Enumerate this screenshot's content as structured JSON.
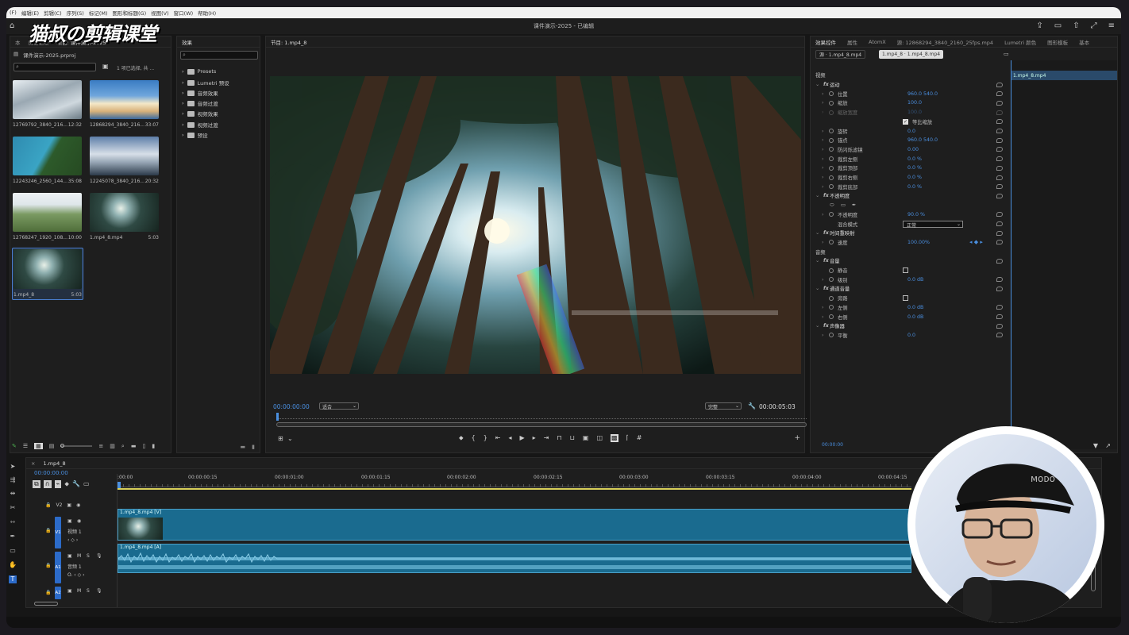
{
  "menubar": {
    "items": [
      "(F)",
      "编辑(E)",
      "剪辑(C)",
      "序列(S)",
      "标记(M)",
      "图形和标题(G)",
      "视图(V)",
      "窗口(W)",
      "帮助(H)"
    ]
  },
  "watermark": "猫叔の剪辑课堂",
  "title": "课件演示-2025 - 已编辑",
  "project_panel": {
    "tabs": [
      "本",
      "历史记录",
      "项目: 课件演示-2025"
    ],
    "project_file": "课件演示-2025.prproj",
    "selection_text": "1 项已选择, 共 ...",
    "items": [
      {
        "name": "12769792_3840_216...",
        "duration": "12:32"
      },
      {
        "name": "12868294_3840_216...",
        "duration": "33:07"
      },
      {
        "name": "12243246_2560_144...",
        "duration": "35:08"
      },
      {
        "name": "12245078_3840_216...",
        "duration": "20:32"
      },
      {
        "name": "12768247_1920_108...",
        "duration": "10:00"
      },
      {
        "name": "1.mp4_8.mp4",
        "duration": "5:03"
      },
      {
        "name": "1.mp4_8",
        "duration": "5:03"
      }
    ]
  },
  "effects_panel": {
    "tab": "效果",
    "folders": [
      "Presets",
      "Lumetri 预设",
      "音频效果",
      "音频过渡",
      "视频效果",
      "视频过渡",
      "预设"
    ]
  },
  "program_monitor": {
    "tab": "节目: 1.mp4_8",
    "timecode": "00:00:00:00",
    "fit": "适合",
    "quality": "完整",
    "duration": "00:00:05:03"
  },
  "effect_controls": {
    "tabs": [
      "效果控件",
      "属性",
      "AtomX",
      "源: 12868294_3840_2160_25fps.mp4",
      "Lumetri 颜色",
      "图形模板",
      "基本"
    ],
    "source_chip": "源 · 1.mp4_8.mp4",
    "seq_chip": "1.mp4_8 · 1.mp4_8.mp4",
    "clip_label": "1.mp4_8.mp4",
    "timecode": "00:00:00",
    "rows": [
      {
        "type": "section",
        "name": "视频"
      },
      {
        "type": "header",
        "name": "运动"
      },
      {
        "type": "prop",
        "name": "位置",
        "value": "960.0    540.0"
      },
      {
        "type": "prop",
        "name": "缩放",
        "value": "100.0"
      },
      {
        "type": "prop",
        "name": "缩放宽度",
        "value": "100.0"
      },
      {
        "type": "check",
        "name": "等比缩放"
      },
      {
        "type": "prop",
        "name": "旋转",
        "value": "0.0"
      },
      {
        "type": "prop",
        "name": "锚点",
        "value": "960.0    540.0"
      },
      {
        "type": "prop",
        "name": "防闪烁滤镜",
        "value": "0.00"
      },
      {
        "type": "prop",
        "name": "裁剪左侧",
        "value": "0.0 %"
      },
      {
        "type": "prop",
        "name": "裁剪顶部",
        "value": "0.0 %"
      },
      {
        "type": "prop",
        "name": "裁剪右侧",
        "value": "0.0 %"
      },
      {
        "type": "prop",
        "name": "裁剪底部",
        "value": "0.0 %"
      },
      {
        "type": "header",
        "name": "不透明度"
      },
      {
        "type": "shapes",
        "name": ""
      },
      {
        "type": "prop",
        "name": "不透明度",
        "value": "90.0 %"
      },
      {
        "type": "dropdown",
        "name": "混合模式",
        "value": "正常"
      },
      {
        "type": "header",
        "name": "时间重映射"
      },
      {
        "type": "prop",
        "name": "速度",
        "value": "100.00%"
      },
      {
        "type": "section",
        "name": "音频"
      },
      {
        "type": "header",
        "name": "音量"
      },
      {
        "type": "checkprop",
        "name": "静音"
      },
      {
        "type": "prop",
        "name": "级别",
        "value": "0.0 dB"
      },
      {
        "type": "header",
        "name": "通道音量"
      },
      {
        "type": "checkprop",
        "name": "旁路"
      },
      {
        "type": "prop",
        "name": "左侧",
        "value": "0.0 dB"
      },
      {
        "type": "prop",
        "name": "右侧",
        "value": "0.0 dB"
      },
      {
        "type": "header",
        "name": "声像器"
      },
      {
        "type": "prop",
        "name": "平衡",
        "value": "0.0"
      }
    ]
  },
  "timeline": {
    "tab": "1.mp4_8",
    "timecode": "00:00:00:00",
    "ruler": [
      ":00:00",
      "00:00:00:15",
      "00:00:01:00",
      "00:00:01:15",
      "00:00:02:00",
      "00:00:02:15",
      "00:00:03:00",
      "00:00:03:15",
      "00:00:04:00",
      "00:00:04:15"
    ],
    "tracks": [
      {
        "id": "V2",
        "label": ""
      },
      {
        "id": "V1",
        "label": "视频 1"
      },
      {
        "id": "A1",
        "label": "音频 1"
      },
      {
        "id": "A2",
        "label": ""
      }
    ],
    "video_clip": "1.mp4_8.mp4 [V]",
    "audio_clip": "1.mp4_8.mp4 [A]"
  }
}
